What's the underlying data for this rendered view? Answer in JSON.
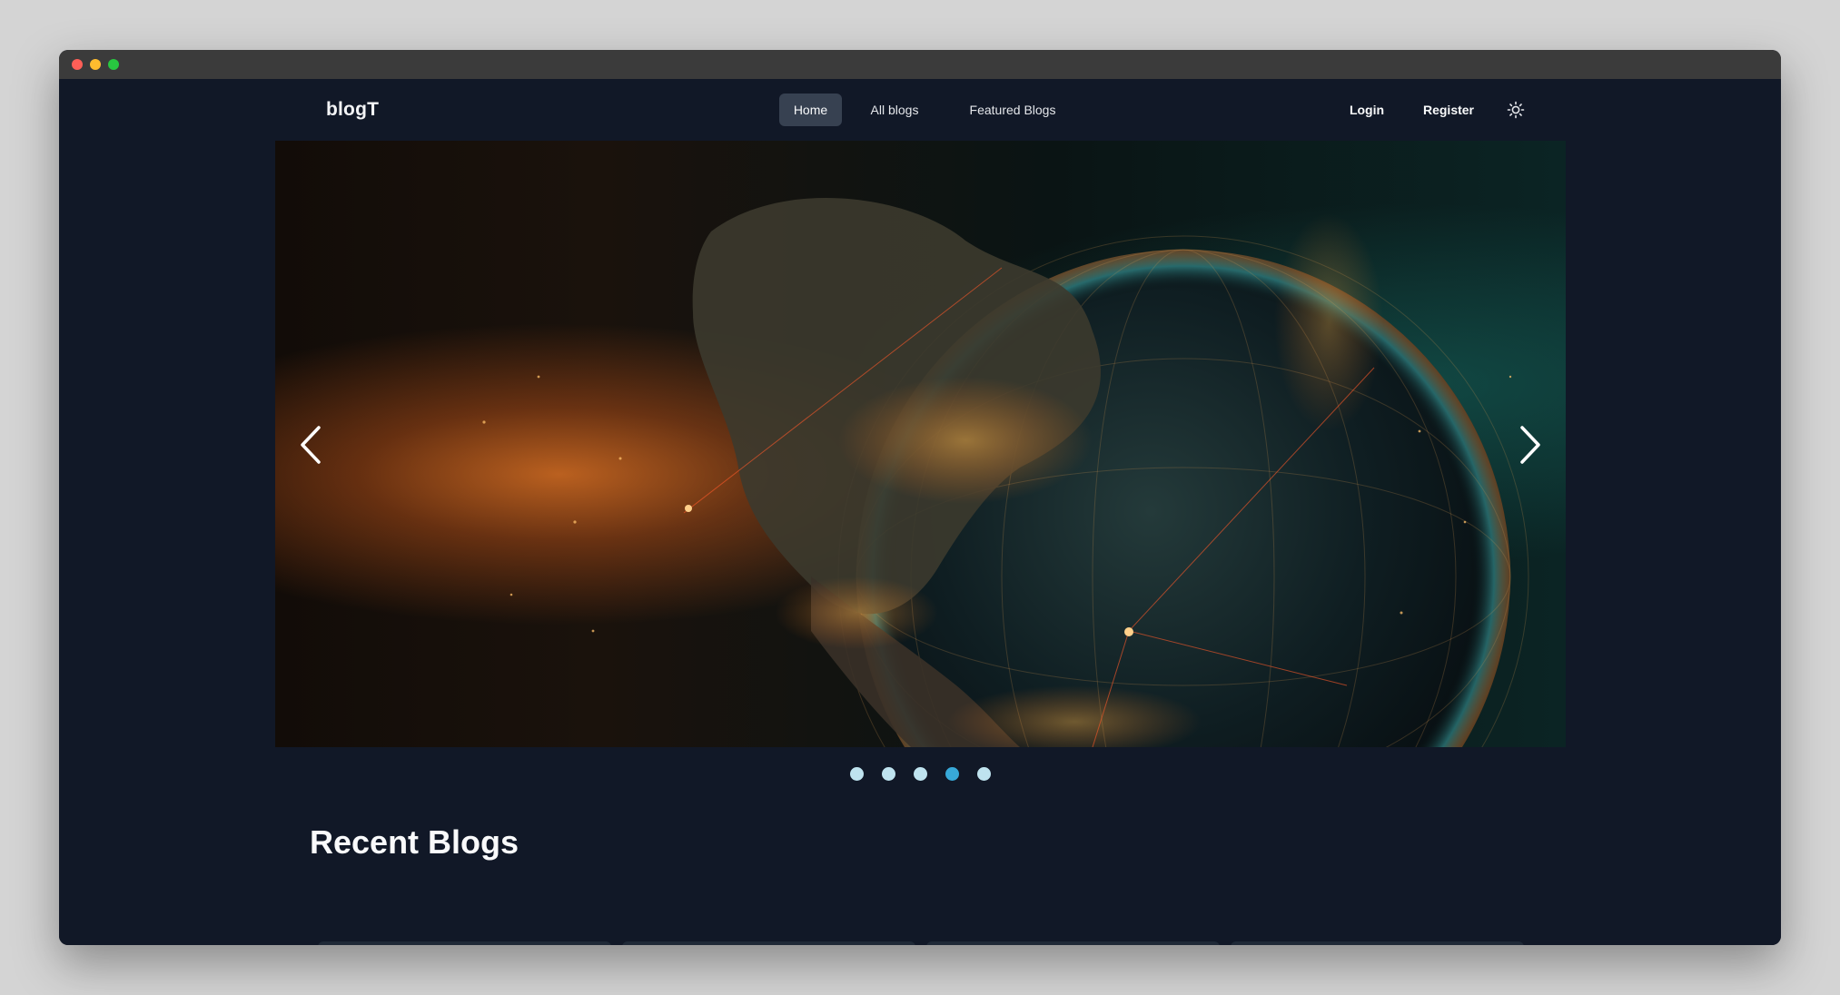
{
  "nav": {
    "brand": "blogT",
    "links": [
      {
        "label": "Home",
        "active": true
      },
      {
        "label": "All blogs",
        "active": false
      },
      {
        "label": "Featured Blogs",
        "active": false
      }
    ],
    "login_label": "Login",
    "register_label": "Register",
    "theme_icon": "sun-icon"
  },
  "hero": {
    "prev_icon": "chevron-left-icon",
    "next_icon": "chevron-right-icon",
    "slide_count": 5,
    "active_slide": 4
  },
  "recent": {
    "title": "Recent Blogs"
  },
  "colors": {
    "page_bg": "#111827",
    "active_nav_bg": "#374151",
    "dot": "#bfe3ef",
    "dot_active": "#38a9d9",
    "card_bg": "#1f2937"
  }
}
